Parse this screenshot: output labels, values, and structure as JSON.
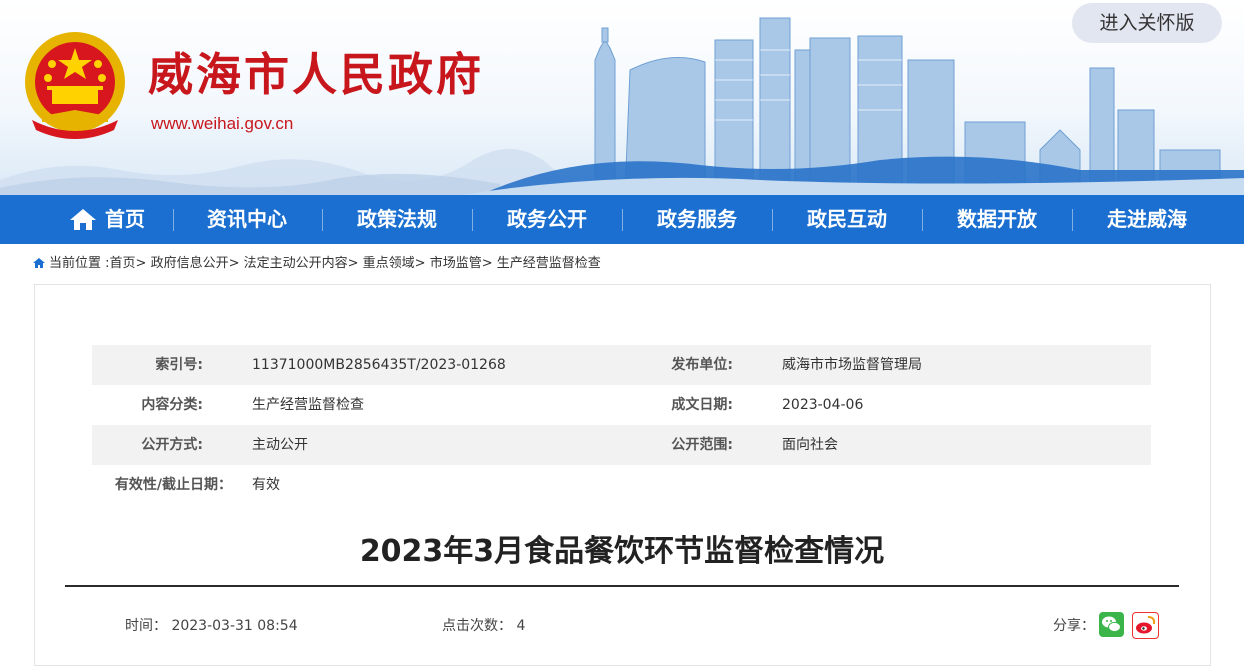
{
  "header": {
    "site_title": "威海市人民政府",
    "site_url": "www.weihai.gov.cn",
    "care_button": "进入关怀版",
    "brand_red": "#c8161d"
  },
  "nav": {
    "color": "#1a6fd0",
    "items": [
      "首页",
      "资讯中心",
      "政策法规",
      "政务公开",
      "政务服务",
      "政民互动",
      "数据开放",
      "走进威海"
    ]
  },
  "breadcrumb": {
    "prefix": "当前位置 :",
    "items": [
      "首页",
      "政府信息公开",
      "法定主动公开内容",
      "重点领域",
      "市场监管",
      "生产经营监督检查"
    ],
    "separator": "> "
  },
  "meta": {
    "rows": [
      {
        "l1": "索引号:",
        "v1": "11371000MB2856435T/2023-01268",
        "l2": "发布单位:",
        "v2": "威海市市场监督管理局"
      },
      {
        "l1": "内容分类:",
        "v1": "生产经营监督检查",
        "l2": "成文日期:",
        "v2": "2023-04-06"
      },
      {
        "l1": "公开方式:",
        "v1": "主动公开",
        "l2": "公开范围:",
        "v2": "面向社会"
      },
      {
        "l1": "有效性/截止日期：",
        "v1": "有效",
        "l2": "",
        "v2": ""
      }
    ]
  },
  "article": {
    "title": "2023年3月食品餐饮环节监督检查情况",
    "time_label": "时间：",
    "time_value": "2023-03-31 08:54",
    "clicks_label": "点击次数：",
    "clicks_value": "4",
    "share_label": "分享："
  },
  "icons": {
    "home": "home-icon",
    "location": "location-icon",
    "wechat": "wechat-icon",
    "weibo": "weibo-icon"
  }
}
